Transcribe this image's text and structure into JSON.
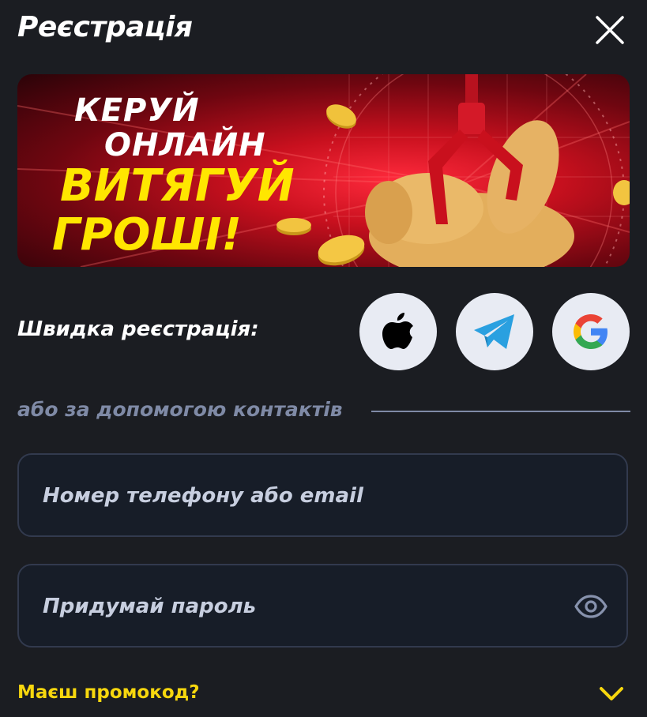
{
  "header": {
    "title": "Реєстрація",
    "close_icon": "close-icon"
  },
  "banner": {
    "line1": "КЕРУЙ",
    "line2": "ОНЛАЙН",
    "line3": "ВИТЯГУЙ",
    "line4": "ГРОШІ!",
    "colors": {
      "white_text": "#ffffff",
      "yellow_text": "#ffe600",
      "background": "#c8101e"
    }
  },
  "quick_registration": {
    "label": "Швидка реєстрація:",
    "providers": [
      {
        "name": "Apple",
        "icon": "apple-icon"
      },
      {
        "name": "Telegram",
        "icon": "telegram-icon"
      },
      {
        "name": "Google",
        "icon": "google-icon"
      }
    ]
  },
  "divider": {
    "text": "або за допомогою контактів"
  },
  "form": {
    "contact_placeholder": "Номер телефону або email",
    "contact_value": "",
    "password_placeholder": "Придумай пароль",
    "password_value": "",
    "password_toggle_icon": "eye-icon"
  },
  "promo": {
    "label": "Маєш промокод?",
    "icon": "chevron-down-icon",
    "color": "#f7d70e"
  }
}
